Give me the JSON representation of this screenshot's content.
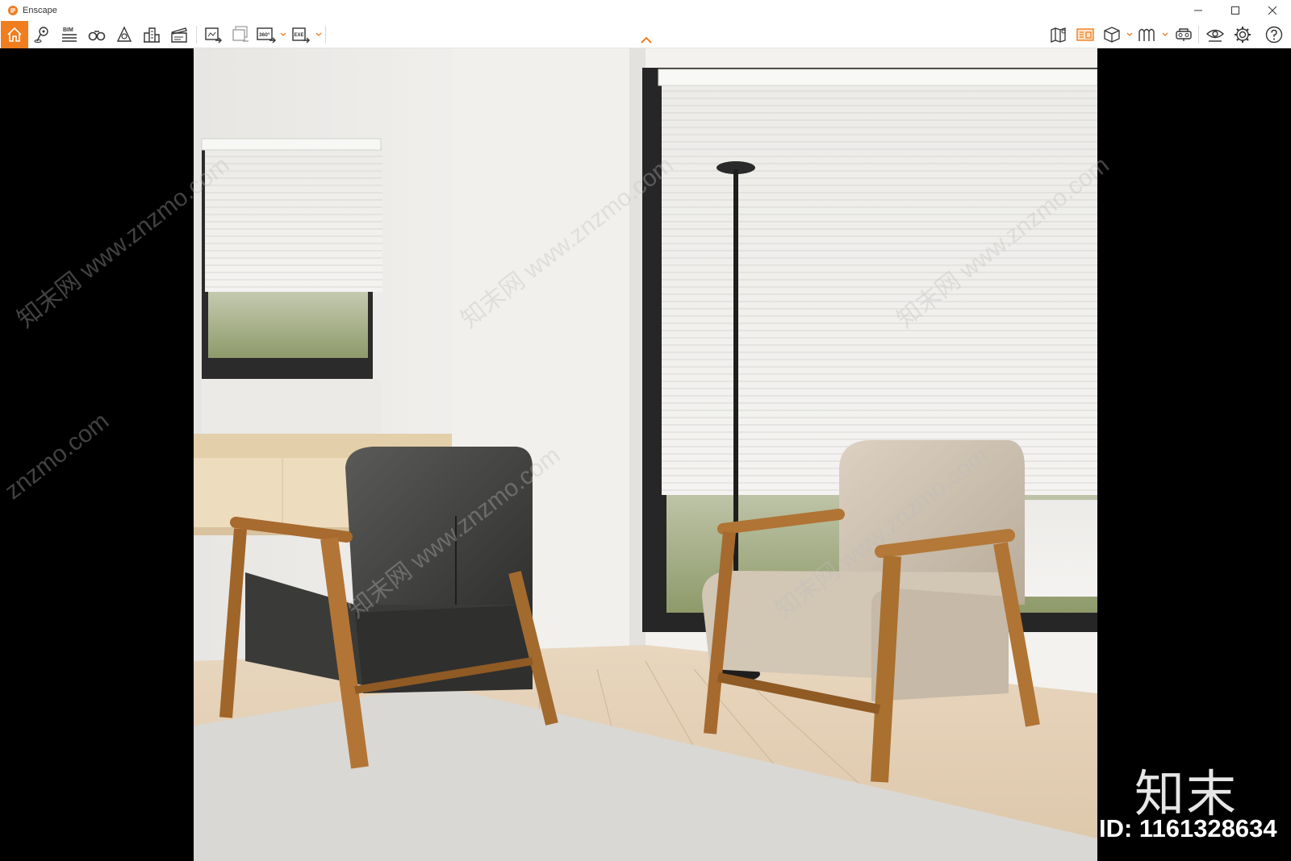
{
  "window": {
    "title": "Enscape",
    "controls": [
      "minimize-icon",
      "maximize-icon",
      "close-icon"
    ]
  },
  "toolbar": {
    "left_icons": [
      "home-icon",
      "location-pin-icon",
      "bim-icon",
      "binoculars-icon",
      "atmosphere-icon",
      "building-icon",
      "clapper-icon",
      "render-screenshot-icon",
      "batch-render-icon",
      "panorama-360-icon",
      "export-exe-icon"
    ],
    "bim_label": "BIM",
    "panorama_label": "360°",
    "exe_label": "EXE",
    "right_icons": [
      "map-icon",
      "views-icon",
      "cube-view-icon",
      "section-icon",
      "vr-headset-icon",
      "visibility-icon",
      "settings-icon",
      "help-icon"
    ],
    "accent_color": "#f07d1e"
  },
  "watermarks": {
    "site_text": "知末网 www.znzmo.com",
    "site_short": "znzmo.com",
    "brand": "知末",
    "id_label": "ID: 1161328634"
  }
}
